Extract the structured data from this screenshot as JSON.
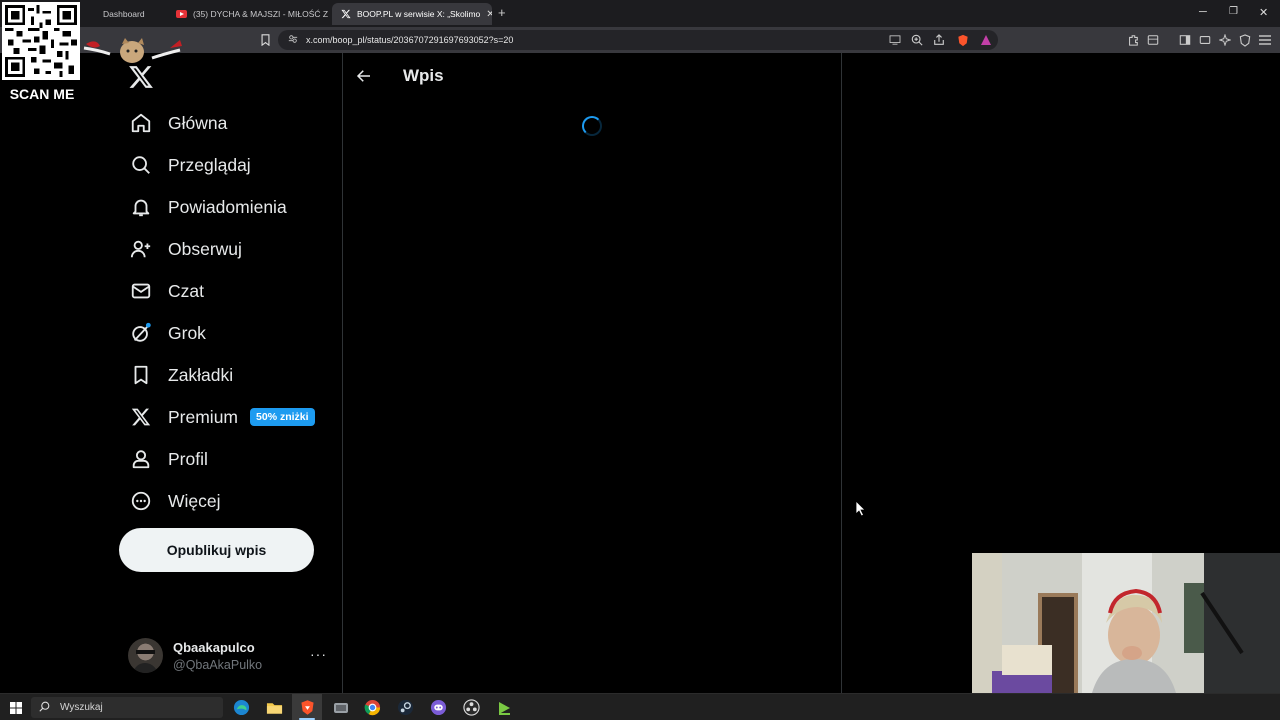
{
  "browser": {
    "tabs": [
      {
        "title": "Dashboard",
        "icon": "dashboard-icon"
      },
      {
        "title": "(35) DYCHA & MAJSZI - MIŁOŚĆ ZA",
        "icon": "youtube-icon"
      },
      {
        "title": "BOOP.PL w serwisie X: „Skolimo",
        "icon": "x-icon"
      }
    ],
    "url": "x.com/boop_pl/status/2036707291697693052?s=20"
  },
  "overlay": {
    "scan_label": "SCAN ME"
  },
  "sidebar": {
    "items": [
      {
        "label": "Główna",
        "icon": "home-icon"
      },
      {
        "label": "Przeglądaj",
        "icon": "search-icon"
      },
      {
        "label": "Powiadomienia",
        "icon": "bell-icon"
      },
      {
        "label": "Obserwuj",
        "icon": "follow-icon"
      },
      {
        "label": "Czat",
        "icon": "mail-icon"
      },
      {
        "label": "Grok",
        "icon": "grok-icon"
      },
      {
        "label": "Zakładki",
        "icon": "bookmark-icon"
      },
      {
        "label": "Premium",
        "icon": "x-icon",
        "badge": "50% zniżki"
      },
      {
        "label": "Profil",
        "icon": "profile-icon"
      },
      {
        "label": "Więcej",
        "icon": "more-icon"
      }
    ],
    "post_button": "Opublikuj wpis",
    "account": {
      "name": "Qbaakapulco",
      "handle": "@QbaAkaPulko",
      "more": "···"
    }
  },
  "main": {
    "title": "Wpis",
    "loading": true
  },
  "taskbar": {
    "search_placeholder": "Wyszukaj"
  },
  "colors": {
    "accent": "#1d9bf0",
    "background": "#000000",
    "text": "#e7e9ea",
    "muted": "#71767b",
    "border": "#2f3336"
  }
}
